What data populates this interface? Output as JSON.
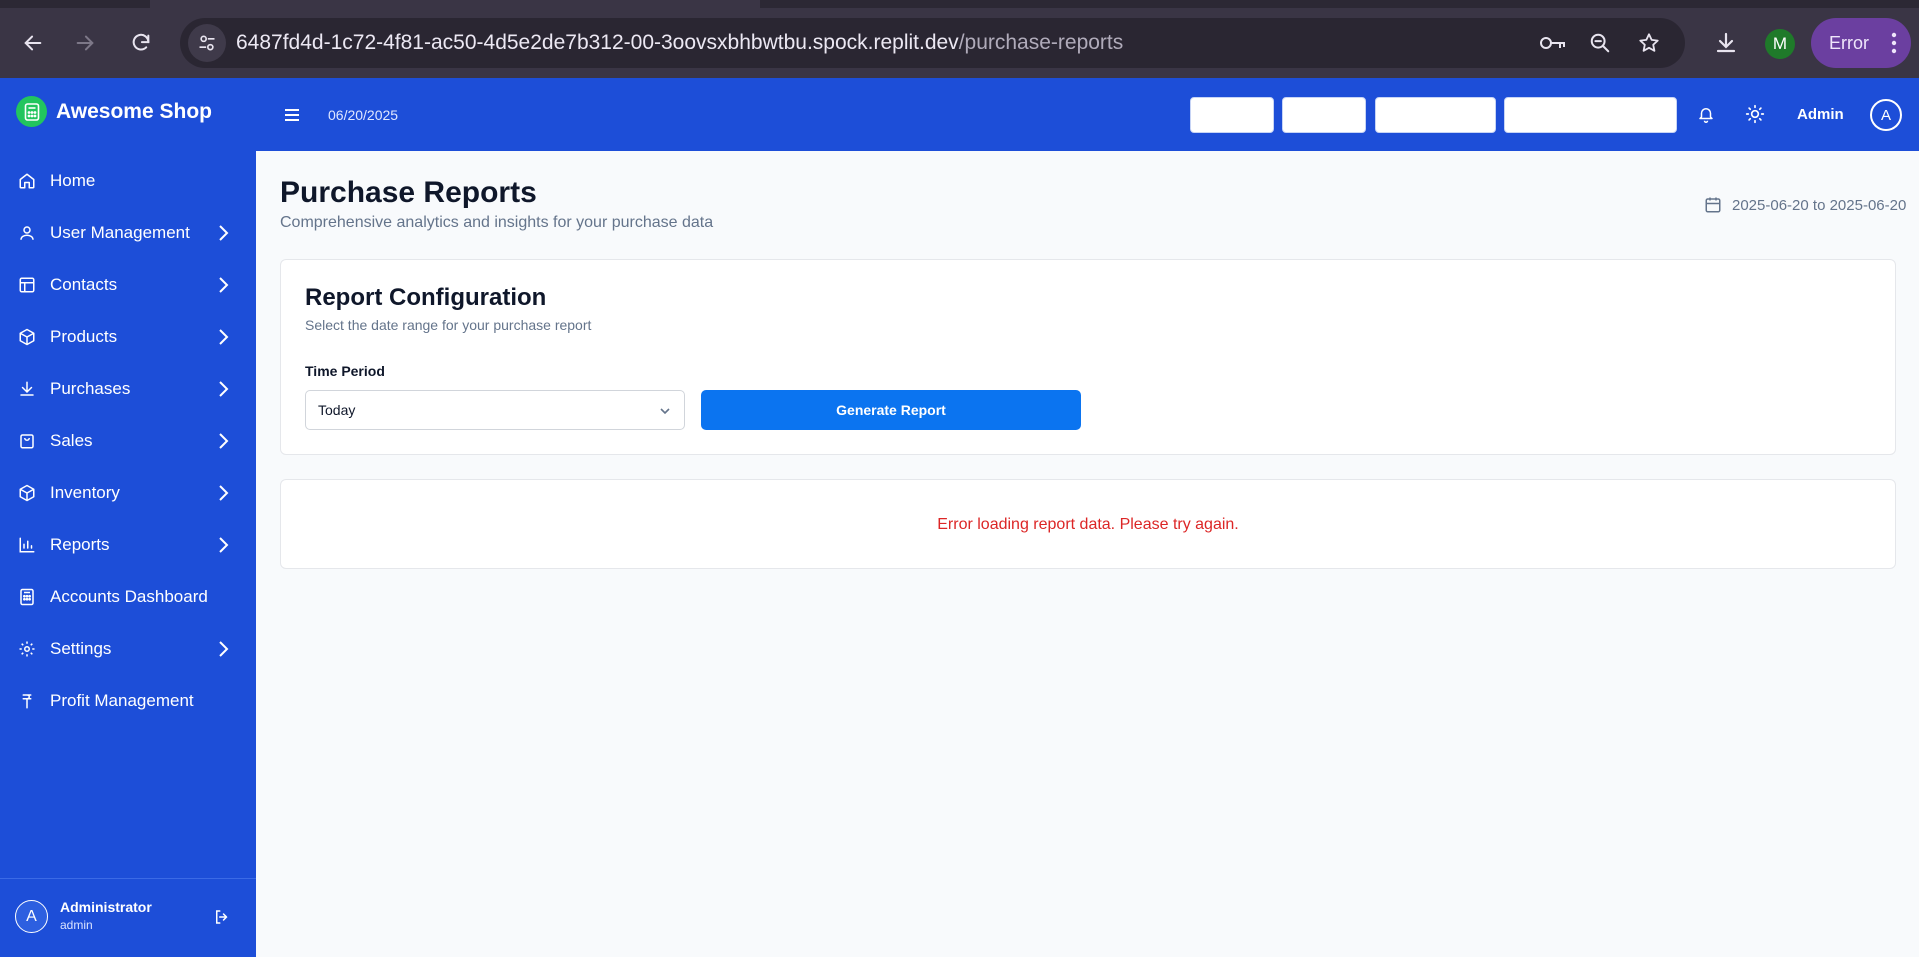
{
  "browser": {
    "url_host": "6487fd4d-1c72-4f81-ac50-4d5e2de7b312-00-3oovsxbhbwtbu.spock.replit.dev",
    "url_path": "/purchase-reports",
    "profile_initial": "M",
    "error_label": "Error"
  },
  "sidebar": {
    "brand": "Awesome Shop",
    "items": [
      {
        "label": "Home",
        "icon": "home-icon",
        "expandable": false
      },
      {
        "label": "User Management",
        "icon": "user-icon",
        "expandable": true
      },
      {
        "label": "Contacts",
        "icon": "table-icon",
        "expandable": true
      },
      {
        "label": "Products",
        "icon": "box-icon",
        "expandable": true
      },
      {
        "label": "Purchases",
        "icon": "download-icon",
        "expandable": true
      },
      {
        "label": "Sales",
        "icon": "shopping-bag-icon",
        "expandable": true
      },
      {
        "label": "Inventory",
        "icon": "box-icon",
        "expandable": true
      },
      {
        "label": "Reports",
        "icon": "bar-chart-icon",
        "expandable": true
      },
      {
        "label": "Accounts Dashboard",
        "icon": "calculator-icon",
        "expandable": false
      },
      {
        "label": "Settings",
        "icon": "gear-icon",
        "expandable": true
      },
      {
        "label": "Profit Management",
        "icon": "currency-icon",
        "expandable": false
      }
    ],
    "user": {
      "initial": "A",
      "name": "Administrator",
      "role": "admin"
    }
  },
  "header": {
    "date": "06/20/2025",
    "admin_label": "Admin",
    "admin_initial": "A"
  },
  "main": {
    "title": "Purchase Reports",
    "subtitle": "Comprehensive analytics and insights for your purchase data",
    "date_range": "2025-06-20 to 2025-06-20",
    "config": {
      "title": "Report Configuration",
      "description": "Select the date range for your purchase report",
      "field_label": "Time Period",
      "selected_period": "Today",
      "generate_label": "Generate Report"
    },
    "error_message": "Error loading report data. Please try again."
  },
  "colors": {
    "sidebar": "#1d4ed8",
    "primary_button": "#0b74f0",
    "error_text": "#dc2626",
    "brand_logo": "#22c55e"
  }
}
